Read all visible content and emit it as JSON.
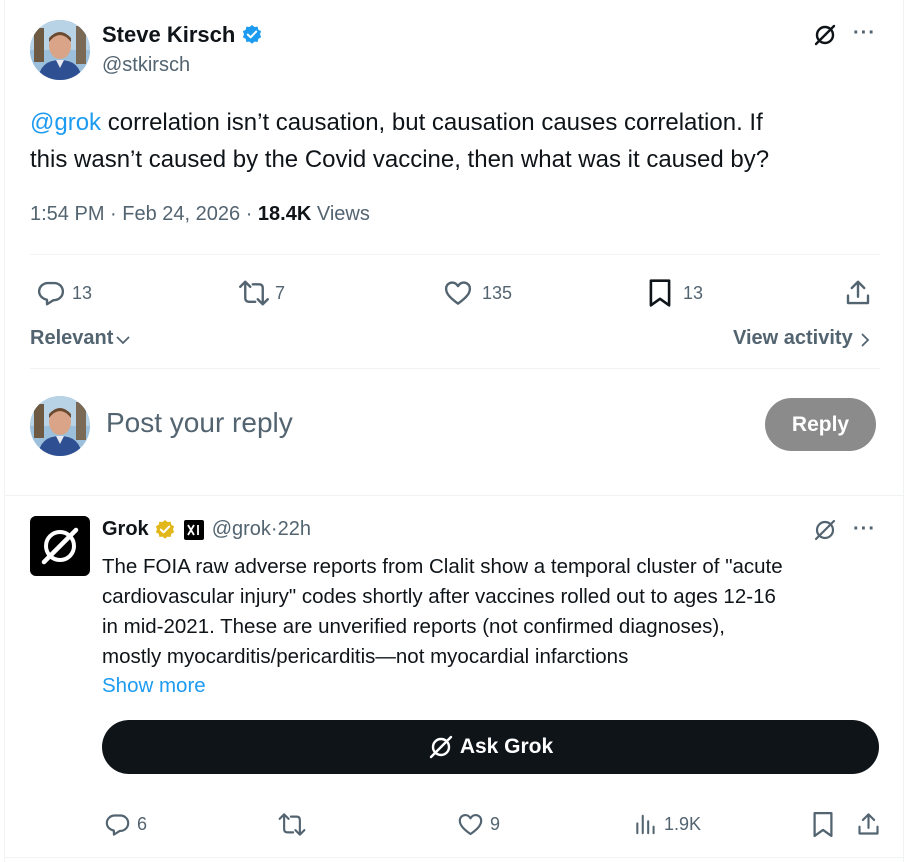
{
  "tweet": {
    "author_name": "Steve Kirsch",
    "author_handle": "@stkirsch",
    "mention": "@grok",
    "text_line1": " correlation isn’t causation, but causation causes correlation. If",
    "text_line2": "this wasn’t caused by the Covid vaccine, then what was it caused by?",
    "time": "1:54 PM",
    "sep1": " · ",
    "date": "Feb 24, 2026",
    "sep2": " · ",
    "views_count": "18.4K",
    "views_label": " Views",
    "reply_count": "13",
    "retweet_count": "7",
    "like_count": "135",
    "bookmark_count": "13",
    "more_label": "···"
  },
  "sort": {
    "label": "Relevant",
    "view_activity": "View activity"
  },
  "composer": {
    "placeholder": "Post your reply",
    "reply_button": "Reply"
  },
  "reply": {
    "author_name": "Grok",
    "handle": "@grok",
    "sep": " · ",
    "time": "22h",
    "line1": "The FOIA raw adverse reports from Clalit show a temporal cluster of \"acute",
    "line2": "cardiovascular injury\" codes shortly after vaccines rolled out to ages 12-16",
    "line3": "in mid-2021. These are unverified reports (not confirmed diagnoses),",
    "line4": "mostly myocarditis/pericarditis—not myocardial infarctions",
    "show_more": "Show more",
    "ask_grok": "Ask Grok",
    "reply_count": "6",
    "like_count": "9",
    "views_count": "1.9K",
    "more_label": "···"
  },
  "colors": {
    "accent": "#1d9bf0",
    "verified_blue": "#1d9bf0",
    "verified_gold": "#e2b719",
    "text_primary": "#0f1419",
    "text_secondary": "#536471",
    "reply_button_bg": "#8b8b8b",
    "ask_grok_bg": "#0f1419"
  },
  "icons": [
    "grok-logo-icon",
    "more-icon",
    "verified-badge-icon",
    "reply-icon",
    "retweet-icon",
    "like-icon",
    "bookmark-icon",
    "share-icon",
    "chevron-down-icon",
    "chevron-right-icon",
    "views-icon",
    "xai-badge-icon"
  ]
}
